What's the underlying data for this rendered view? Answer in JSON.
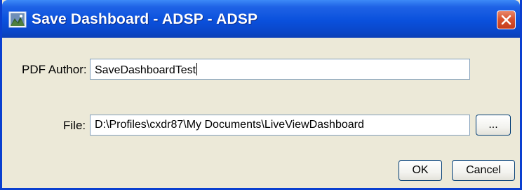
{
  "dialog": {
    "title": "Save Dashboard - ADSP - ADSP"
  },
  "form": {
    "pdf_author_label": "PDF Author:",
    "pdf_author_value": "SaveDashboardTest",
    "file_label": "File:",
    "file_value": "D:\\Profiles\\cxdr87\\My Documents\\LiveViewDashboard",
    "browse_label": "..."
  },
  "buttons": {
    "ok_label": "OK",
    "cancel_label": "Cancel"
  },
  "colors": {
    "titlebar": "#0a50dc",
    "close_button": "#d8532f",
    "client_background": "#ece9d8",
    "field_border": "#7f9db9"
  },
  "icons": {
    "app": "dashboard-app-icon",
    "close": "close-icon"
  }
}
